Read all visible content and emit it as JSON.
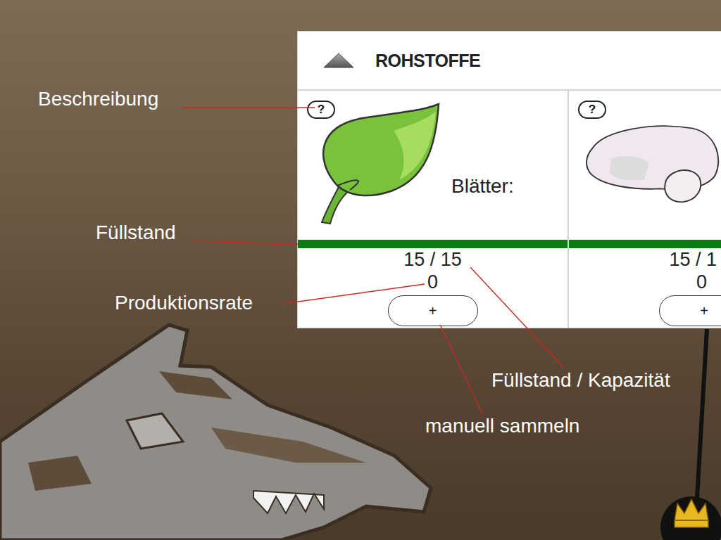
{
  "annotations": [
    {
      "label": "Beschreibung"
    },
    {
      "label": "Füllstand"
    },
    {
      "label": "Produktionsrate"
    },
    {
      "label": "Füllstand / Kapazität"
    },
    {
      "label": "manuell sammeln"
    }
  ],
  "panel": {
    "title": "ROHSTOFFE",
    "expanded": true,
    "resources": [
      {
        "kind": "leaf",
        "name": "Blätter:",
        "help": "?",
        "level": 1,
        "fill": "15 / 15",
        "rate": "0",
        "collect": "+"
      },
      {
        "kind": "stone",
        "help": "?",
        "level": 1,
        "fill": "15 / 1",
        "rate": "0",
        "collect": "+"
      }
    ]
  }
}
